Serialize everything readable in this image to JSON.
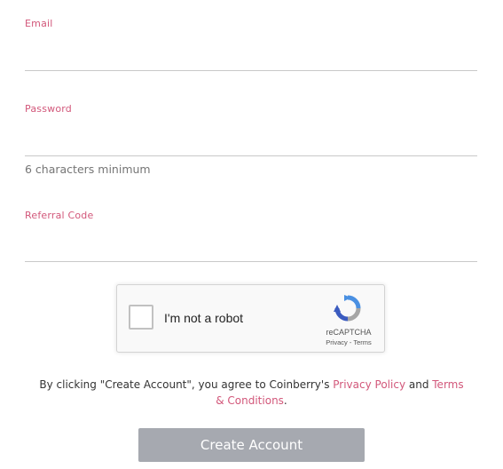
{
  "form": {
    "email": {
      "label": "Email",
      "value": ""
    },
    "password": {
      "label": "Password",
      "value": "",
      "hint": "6 characters minimum"
    },
    "referral": {
      "label": "Referral Code",
      "value": ""
    }
  },
  "recaptcha": {
    "label": "I'm not a robot",
    "brand": "reCAPTCHA",
    "privacy": "Privacy",
    "separator": " - ",
    "terms": "Terms",
    "checked": false
  },
  "agreement": {
    "prefix": "By clicking \"Create Account\", you agree to Coinberry's ",
    "privacy_link": "Privacy Policy",
    "middle": " and ",
    "terms_link": "Terms & Conditions",
    "suffix": "."
  },
  "submit": {
    "label": "Create Account"
  },
  "colors": {
    "accent": "#d2577a",
    "button": "#a6a9b0",
    "recaptcha_blue": "#4a90e2",
    "recaptcha_gray": "#a6a6a6"
  }
}
